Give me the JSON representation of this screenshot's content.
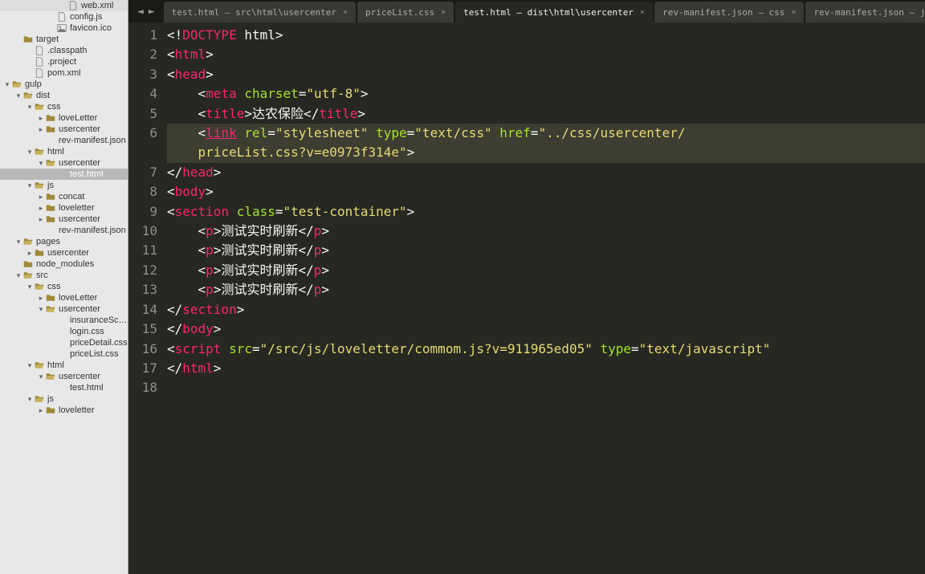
{
  "sidebar": {
    "items": [
      {
        "depth": 5,
        "exp": "",
        "icon": "file",
        "label": "web.xml"
      },
      {
        "depth": 4,
        "exp": "",
        "icon": "file",
        "label": "config.js"
      },
      {
        "depth": 4,
        "exp": "",
        "icon": "image",
        "label": "favicon.ico"
      },
      {
        "depth": 1,
        "exp": "",
        "icon": "folder",
        "label": "target"
      },
      {
        "depth": 2,
        "exp": "",
        "icon": "file",
        "label": ".classpath"
      },
      {
        "depth": 2,
        "exp": "",
        "icon": "file",
        "label": ".project"
      },
      {
        "depth": 2,
        "exp": "",
        "icon": "file",
        "label": "pom.xml"
      },
      {
        "depth": 0,
        "exp": "▾",
        "icon": "folder-open",
        "label": "gulp"
      },
      {
        "depth": 1,
        "exp": "▾",
        "icon": "folder-open",
        "label": "dist"
      },
      {
        "depth": 2,
        "exp": "▾",
        "icon": "folder-open",
        "label": "css"
      },
      {
        "depth": 3,
        "exp": "▸",
        "icon": "folder",
        "label": "loveLetter"
      },
      {
        "depth": 3,
        "exp": "▸",
        "icon": "folder",
        "label": "usercenter"
      },
      {
        "depth": 3,
        "exp": "",
        "icon": "none",
        "label": "rev-manifest.json"
      },
      {
        "depth": 2,
        "exp": "▾",
        "icon": "folder-open",
        "label": "html"
      },
      {
        "depth": 3,
        "exp": "▾",
        "icon": "folder-open",
        "label": "usercenter"
      },
      {
        "depth": 4,
        "exp": "",
        "icon": "none",
        "label": "test.html",
        "selected": true
      },
      {
        "depth": 2,
        "exp": "▾",
        "icon": "folder-open",
        "label": "js"
      },
      {
        "depth": 3,
        "exp": "▸",
        "icon": "folder",
        "label": "concat"
      },
      {
        "depth": 3,
        "exp": "▸",
        "icon": "folder",
        "label": "loveletter"
      },
      {
        "depth": 3,
        "exp": "▸",
        "icon": "folder",
        "label": "usercenter"
      },
      {
        "depth": 3,
        "exp": "",
        "icon": "none",
        "label": "rev-manifest.json"
      },
      {
        "depth": 1,
        "exp": "▾",
        "icon": "folder-open",
        "label": "pages"
      },
      {
        "depth": 2,
        "exp": "▸",
        "icon": "folder",
        "label": "usercenter"
      },
      {
        "depth": 1,
        "exp": "",
        "icon": "folder",
        "label": "node_modules"
      },
      {
        "depth": 1,
        "exp": "▾",
        "icon": "folder-open",
        "label": "src"
      },
      {
        "depth": 2,
        "exp": "▾",
        "icon": "folder-open",
        "label": "css"
      },
      {
        "depth": 3,
        "exp": "▸",
        "icon": "folder",
        "label": "loveLetter"
      },
      {
        "depth": 3,
        "exp": "▾",
        "icon": "folder-open",
        "label": "usercenter"
      },
      {
        "depth": 4,
        "exp": "",
        "icon": "none",
        "label": "insuranceSchem"
      },
      {
        "depth": 4,
        "exp": "",
        "icon": "none",
        "label": "login.css"
      },
      {
        "depth": 4,
        "exp": "",
        "icon": "none",
        "label": "priceDetail.css"
      },
      {
        "depth": 4,
        "exp": "",
        "icon": "none",
        "label": "priceList.css"
      },
      {
        "depth": 2,
        "exp": "▾",
        "icon": "folder-open",
        "label": "html"
      },
      {
        "depth": 3,
        "exp": "▾",
        "icon": "folder-open",
        "label": "usercenter"
      },
      {
        "depth": 4,
        "exp": "",
        "icon": "none",
        "label": "test.html"
      },
      {
        "depth": 2,
        "exp": "▾",
        "icon": "folder-open",
        "label": "js"
      },
      {
        "depth": 3,
        "exp": "▸",
        "icon": "folder",
        "label": "loveletter"
      }
    ]
  },
  "tabs": [
    {
      "label": "test.html — src\\html\\usercenter",
      "active": false
    },
    {
      "label": "priceList.css",
      "active": false
    },
    {
      "label": "test.html — dist\\html\\usercenter",
      "active": true
    },
    {
      "label": "rev-manifest.json — css",
      "active": false
    },
    {
      "label": "rev-manifest.json — js",
      "active": false
    }
  ],
  "lineNumbers": [
    1,
    2,
    3,
    4,
    5,
    6,
    7,
    8,
    9,
    10,
    11,
    12,
    13,
    14,
    15,
    16,
    17,
    18
  ],
  "modifiedLine": 6,
  "highlightedLine": 6,
  "code": {
    "l1": [
      [
        "white",
        "<!"
      ],
      [
        "red",
        "DOCTYPE"
      ],
      [
        "white",
        " html>"
      ]
    ],
    "l2": [
      [
        "white",
        "<"
      ],
      [
        "red",
        "html"
      ],
      [
        "white",
        ">"
      ]
    ],
    "l3": [
      [
        "white",
        "<"
      ],
      [
        "red",
        "head"
      ],
      [
        "white",
        ">"
      ]
    ],
    "l4": [
      [
        "white",
        "    <"
      ],
      [
        "red",
        "meta"
      ],
      [
        "white",
        " "
      ],
      [
        "green",
        "charset"
      ],
      [
        "white",
        "="
      ],
      [
        "yellow",
        "\"utf-8\""
      ],
      [
        "white",
        ">"
      ]
    ],
    "l5": [
      [
        "white",
        "    <"
      ],
      [
        "red",
        "title"
      ],
      [
        "white",
        ">达农保险</"
      ],
      [
        "red",
        "title"
      ],
      [
        "white",
        ">"
      ]
    ],
    "l6": [
      [
        "white",
        "    <"
      ],
      [
        "red underline",
        "link"
      ],
      [
        "white",
        " "
      ],
      [
        "green",
        "rel"
      ],
      [
        "white",
        "="
      ],
      [
        "yellow",
        "\"stylesheet\""
      ],
      [
        "white",
        " "
      ],
      [
        "green",
        "type"
      ],
      [
        "white",
        "="
      ],
      [
        "yellow",
        "\"text/css\""
      ],
      [
        "white",
        " "
      ],
      [
        "green",
        "href"
      ],
      [
        "white",
        "="
      ],
      [
        "yellow",
        "\"../css/usercenter/"
      ]
    ],
    "l6b": [
      [
        "yellow",
        "    priceList.css?v=e0973f314e\""
      ],
      [
        "white",
        ">"
      ]
    ],
    "l7": [
      [
        "white",
        "</"
      ],
      [
        "red",
        "head"
      ],
      [
        "white",
        ">"
      ]
    ],
    "l8": [
      [
        "white",
        "<"
      ],
      [
        "red",
        "body"
      ],
      [
        "white",
        ">"
      ]
    ],
    "l9": [
      [
        "white",
        "<"
      ],
      [
        "red",
        "section"
      ],
      [
        "white",
        " "
      ],
      [
        "green",
        "class"
      ],
      [
        "white",
        "="
      ],
      [
        "yellow",
        "\"test-container\""
      ],
      [
        "white",
        ">"
      ]
    ],
    "l10": [
      [
        "white",
        "    <"
      ],
      [
        "red",
        "p"
      ],
      [
        "white",
        ">测试实时刷新</"
      ],
      [
        "red",
        "p"
      ],
      [
        "white",
        ">"
      ]
    ],
    "l11": [
      [
        "white",
        "    <"
      ],
      [
        "red",
        "p"
      ],
      [
        "white",
        ">测试实时刷新</"
      ],
      [
        "red",
        "p"
      ],
      [
        "white",
        ">"
      ]
    ],
    "l12": [
      [
        "white",
        "    <"
      ],
      [
        "red",
        "p"
      ],
      [
        "white",
        ">测试实时刷新</"
      ],
      [
        "red",
        "p"
      ],
      [
        "white",
        ">"
      ]
    ],
    "l13": [
      [
        "white",
        "    <"
      ],
      [
        "red",
        "p"
      ],
      [
        "white",
        ">测试实时刷新</"
      ],
      [
        "red",
        "p"
      ],
      [
        "white",
        ">"
      ]
    ],
    "l14": [
      [
        "white",
        "</"
      ],
      [
        "red",
        "section"
      ],
      [
        "white",
        ">"
      ]
    ],
    "l15": [
      [
        "white",
        "</"
      ],
      [
        "red",
        "body"
      ],
      [
        "white",
        ">"
      ]
    ],
    "l16": [
      [
        "white",
        ""
      ]
    ],
    "l17": [
      [
        "white",
        "<"
      ],
      [
        "red",
        "script"
      ],
      [
        "white",
        " "
      ],
      [
        "green",
        "src"
      ],
      [
        "white",
        "="
      ],
      [
        "yellow",
        "\"/src/js/loveletter/commom.js?v=911965ed05\""
      ],
      [
        "white",
        " "
      ],
      [
        "green",
        "type"
      ],
      [
        "white",
        "="
      ],
      [
        "yellow",
        "\"text/javascript\""
      ]
    ],
    "l18": [
      [
        "white",
        "</"
      ],
      [
        "red",
        "html"
      ],
      [
        "white",
        ">"
      ]
    ]
  }
}
